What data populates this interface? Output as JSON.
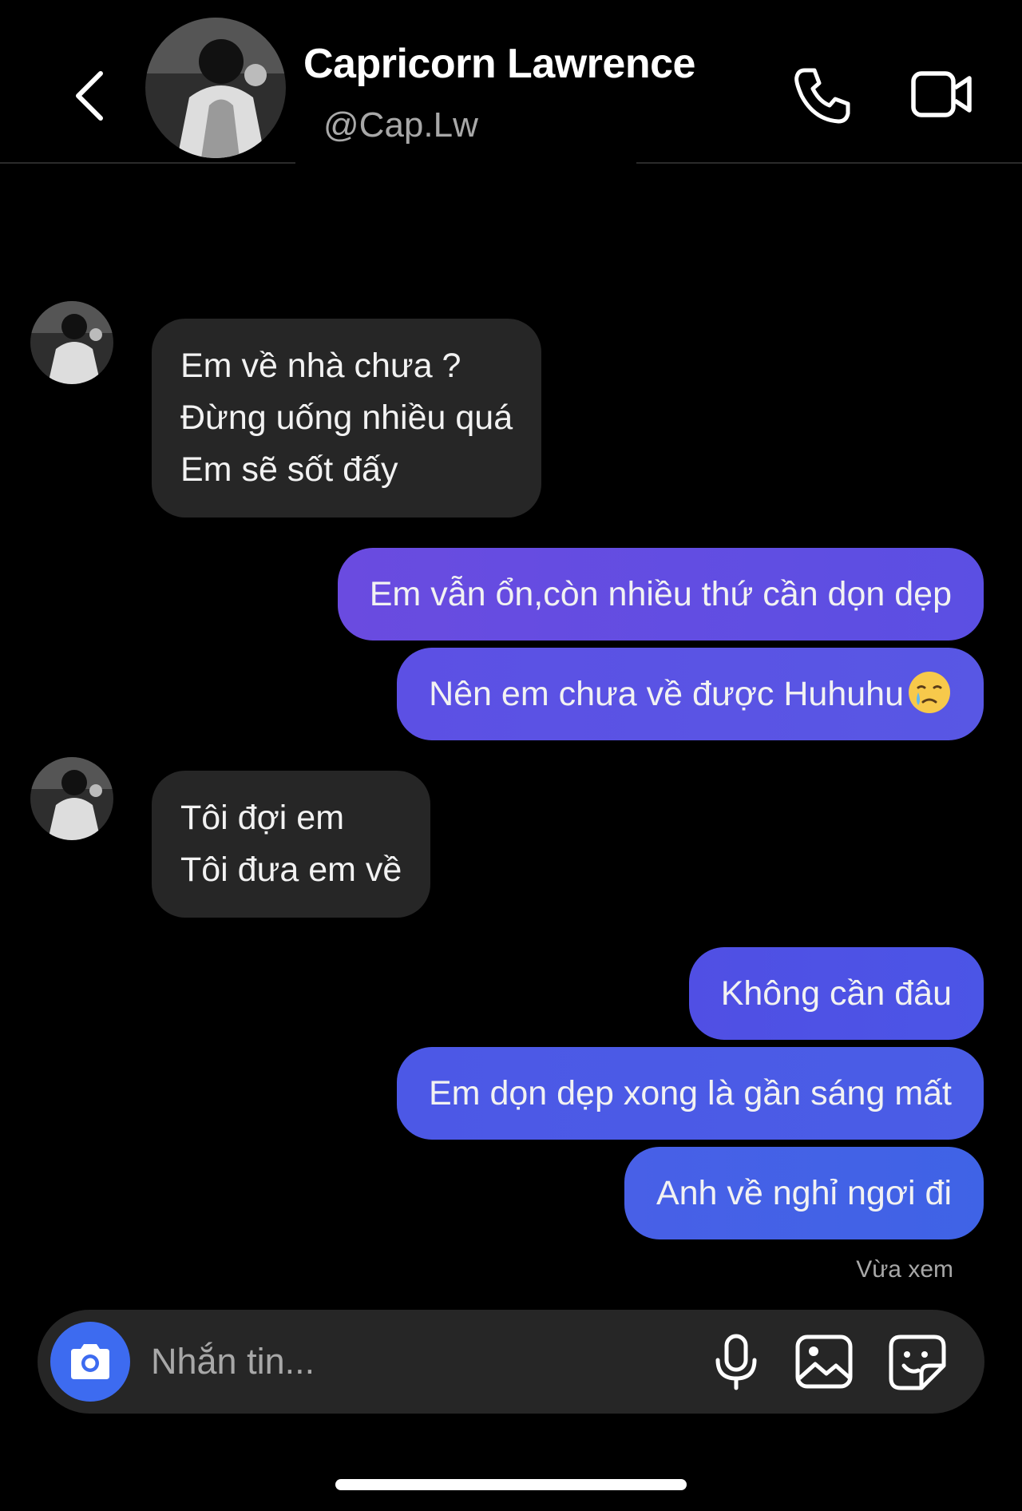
{
  "header": {
    "contact_name": "Capricorn Lawrence",
    "contact_handle": "@Cap.Lw",
    "icons": [
      "chevron-left-icon",
      "phone-icon",
      "video-camera-icon"
    ]
  },
  "messages": [
    {
      "direction": "incoming",
      "lines": [
        "Em về nhà chưa ?",
        "Đừng uống nhiều quá",
        "Em sẽ sốt đấy"
      ]
    },
    {
      "direction": "outgoing",
      "text": "Em vẫn ổn,còn nhiều thứ cần dọn dẹp"
    },
    {
      "direction": "outgoing",
      "text": "Nên em chưa về được Huhuhu",
      "emoji": "crying-face-icon"
    },
    {
      "direction": "incoming",
      "lines": [
        "Tôi đợi em",
        "Tôi đưa em về"
      ]
    },
    {
      "direction": "outgoing",
      "text": "Không cần đâu"
    },
    {
      "direction": "outgoing",
      "text": "Em dọn dẹp xong là gần sáng mất"
    },
    {
      "direction": "outgoing",
      "text": "Anh về nghỉ ngơi đi"
    }
  ],
  "seen_status": "Vừa xem",
  "composer": {
    "placeholder": "Nhắn tin...",
    "icons": [
      "camera-icon",
      "microphone-icon",
      "image-icon",
      "sticker-icon"
    ]
  },
  "colors": {
    "background": "#000000",
    "incoming_bubble": "#262626",
    "outgoing_gradient_start": "#6a4be0",
    "outgoing_gradient_end": "#3f63e6",
    "camera_button": "#3d6bf0"
  }
}
